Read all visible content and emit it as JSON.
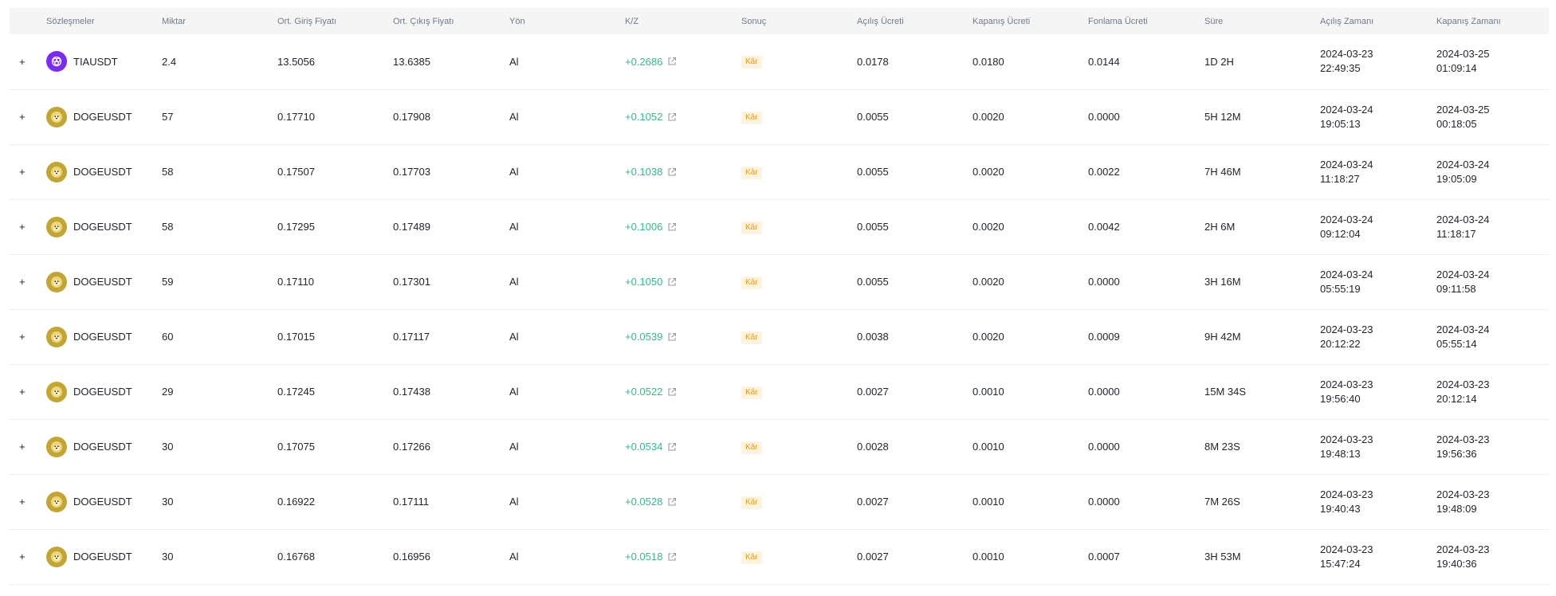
{
  "table": {
    "headers": {
      "contract": "Sözleşmeler",
      "qty": "Miktar",
      "entry": "Ort. Giriş Fiyatı",
      "exit": "Ort. Çıkış Fiyatı",
      "side": "Yön",
      "pnl": "K/Z",
      "result": "Sonuç",
      "open_fee": "Açılış Ücreti",
      "close_fee": "Kapanış Ücreti",
      "funding_fee": "Fonlama Ücreti",
      "duration": "Süre",
      "open_time": "Açılış Zamanı",
      "close_time": "Kapanış Zamanı"
    },
    "rows": [
      {
        "expand": "+",
        "coin_icon": "tia-coin-icon",
        "symbol": "TIAUSDT",
        "qty": "2.4",
        "entry": "13.5056",
        "exit": "13.6385",
        "side": "Al",
        "pnl": "+0.2686",
        "result": "Kâr",
        "open_fee": "0.0178",
        "close_fee": "0.0180",
        "funding_fee": "0.0144",
        "duration": "1D 2H",
        "open_date": "2024-03-23",
        "open_clock": "22:49:35",
        "close_date": "2024-03-25",
        "close_clock": "01:09:14"
      },
      {
        "expand": "+",
        "coin_icon": "doge-coin-icon",
        "symbol": "DOGEUSDT",
        "qty": "57",
        "entry": "0.17710",
        "exit": "0.17908",
        "side": "Al",
        "pnl": "+0.1052",
        "result": "Kâr",
        "open_fee": "0.0055",
        "close_fee": "0.0020",
        "funding_fee": "0.0000",
        "duration": "5H 12M",
        "open_date": "2024-03-24",
        "open_clock": "19:05:13",
        "close_date": "2024-03-25",
        "close_clock": "00:18:05"
      },
      {
        "expand": "+",
        "coin_icon": "doge-coin-icon",
        "symbol": "DOGEUSDT",
        "qty": "58",
        "entry": "0.17507",
        "exit": "0.17703",
        "side": "Al",
        "pnl": "+0.1038",
        "result": "Kâr",
        "open_fee": "0.0055",
        "close_fee": "0.0020",
        "funding_fee": "0.0022",
        "duration": "7H 46M",
        "open_date": "2024-03-24",
        "open_clock": "11:18:27",
        "close_date": "2024-03-24",
        "close_clock": "19:05:09"
      },
      {
        "expand": "+",
        "coin_icon": "doge-coin-icon",
        "symbol": "DOGEUSDT",
        "qty": "58",
        "entry": "0.17295",
        "exit": "0.17489",
        "side": "Al",
        "pnl": "+0.1006",
        "result": "Kâr",
        "open_fee": "0.0055",
        "close_fee": "0.0020",
        "funding_fee": "0.0042",
        "duration": "2H 6M",
        "open_date": "2024-03-24",
        "open_clock": "09:12:04",
        "close_date": "2024-03-24",
        "close_clock": "11:18:17"
      },
      {
        "expand": "+",
        "coin_icon": "doge-coin-icon",
        "symbol": "DOGEUSDT",
        "qty": "59",
        "entry": "0.17110",
        "exit": "0.17301",
        "side": "Al",
        "pnl": "+0.1050",
        "result": "Kâr",
        "open_fee": "0.0055",
        "close_fee": "0.0020",
        "funding_fee": "0.0000",
        "duration": "3H 16M",
        "open_date": "2024-03-24",
        "open_clock": "05:55:19",
        "close_date": "2024-03-24",
        "close_clock": "09:11:58"
      },
      {
        "expand": "+",
        "coin_icon": "doge-coin-icon",
        "symbol": "DOGEUSDT",
        "qty": "60",
        "entry": "0.17015",
        "exit": "0.17117",
        "side": "Al",
        "pnl": "+0.0539",
        "result": "Kâr",
        "open_fee": "0.0038",
        "close_fee": "0.0020",
        "funding_fee": "0.0009",
        "duration": "9H 42M",
        "open_date": "2024-03-23",
        "open_clock": "20:12:22",
        "close_date": "2024-03-24",
        "close_clock": "05:55:14"
      },
      {
        "expand": "+",
        "coin_icon": "doge-coin-icon",
        "symbol": "DOGEUSDT",
        "qty": "29",
        "entry": "0.17245",
        "exit": "0.17438",
        "side": "Al",
        "pnl": "+0.0522",
        "result": "Kâr",
        "open_fee": "0.0027",
        "close_fee": "0.0010",
        "funding_fee": "0.0000",
        "duration": "15M 34S",
        "open_date": "2024-03-23",
        "open_clock": "19:56:40",
        "close_date": "2024-03-23",
        "close_clock": "20:12:14"
      },
      {
        "expand": "+",
        "coin_icon": "doge-coin-icon",
        "symbol": "DOGEUSDT",
        "qty": "30",
        "entry": "0.17075",
        "exit": "0.17266",
        "side": "Al",
        "pnl": "+0.0534",
        "result": "Kâr",
        "open_fee": "0.0028",
        "close_fee": "0.0010",
        "funding_fee": "0.0000",
        "duration": "8M 23S",
        "open_date": "2024-03-23",
        "open_clock": "19:48:13",
        "close_date": "2024-03-23",
        "close_clock": "19:56:36"
      },
      {
        "expand": "+",
        "coin_icon": "doge-coin-icon",
        "symbol": "DOGEUSDT",
        "qty": "30",
        "entry": "0.16922",
        "exit": "0.17111",
        "side": "Al",
        "pnl": "+0.0528",
        "result": "Kâr",
        "open_fee": "0.0027",
        "close_fee": "0.0010",
        "funding_fee": "0.0000",
        "duration": "7M 26S",
        "open_date": "2024-03-23",
        "open_clock": "19:40:43",
        "close_date": "2024-03-23",
        "close_clock": "19:48:09"
      },
      {
        "expand": "+",
        "coin_icon": "doge-coin-icon",
        "symbol": "DOGEUSDT",
        "qty": "30",
        "entry": "0.16768",
        "exit": "0.16956",
        "side": "Al",
        "pnl": "+0.0518",
        "result": "Kâr",
        "open_fee": "0.0027",
        "close_fee": "0.0010",
        "funding_fee": "0.0007",
        "duration": "3H 53M",
        "open_date": "2024-03-23",
        "open_clock": "15:47:24",
        "close_date": "2024-03-23",
        "close_clock": "19:40:36"
      }
    ]
  },
  "colors": {
    "profit": "#2ebd85",
    "badge_text": "#e89b0c",
    "badge_bg": "#fdf3e1",
    "header_bg": "#f5f5f5",
    "tia": "#7b2bf9",
    "doge": "#c2a633"
  }
}
